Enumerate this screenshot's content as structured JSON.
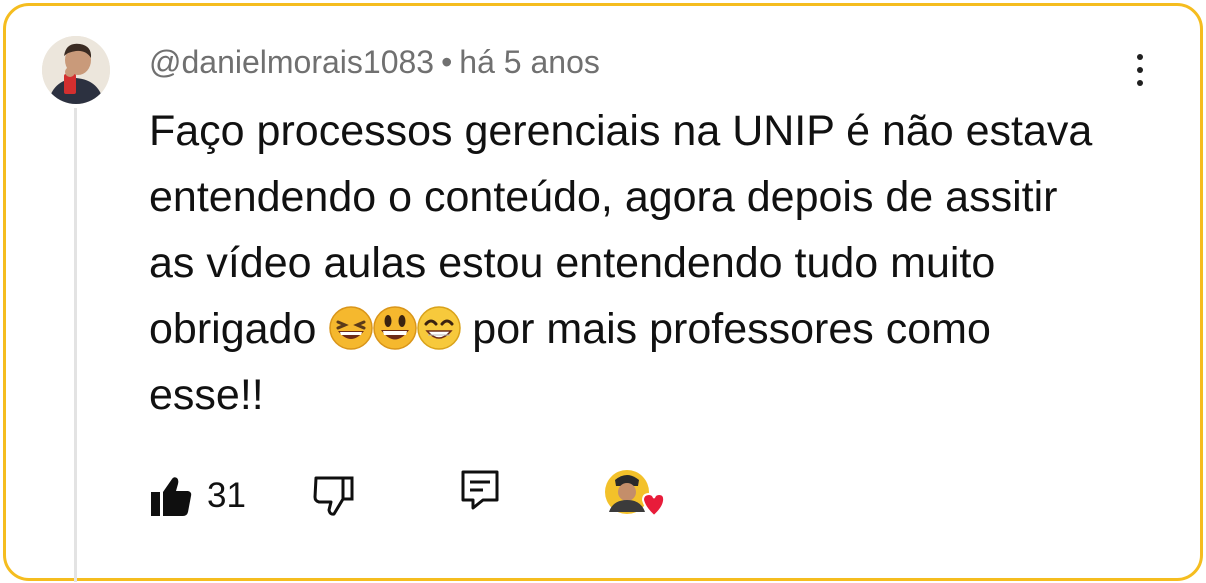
{
  "comment": {
    "username": "@danielmorais1083",
    "separator": "•",
    "timestamp": "há 5 anos",
    "text_lines": [
      "Faço processos gerenciais na UNIP é não estava",
      "entendendo o conteúdo, agora depois de assitir",
      "as vídeo aulas estou entendendo tudo muito",
      "obrigado",
      "por mais professores como",
      "esse!!"
    ],
    "emojis": [
      "grinning-squinting-face",
      "grinning-face-big-eyes",
      "beaming-face"
    ],
    "like_count": "31"
  },
  "colors": {
    "border": "#f5bd1f",
    "heart": "#e81c3a",
    "thread": "#e3e3e3"
  },
  "icons": [
    "kebab-menu-icon",
    "thumbs-up-icon",
    "thumbs-down-icon",
    "reply-icon",
    "creator-heart-icon"
  ]
}
